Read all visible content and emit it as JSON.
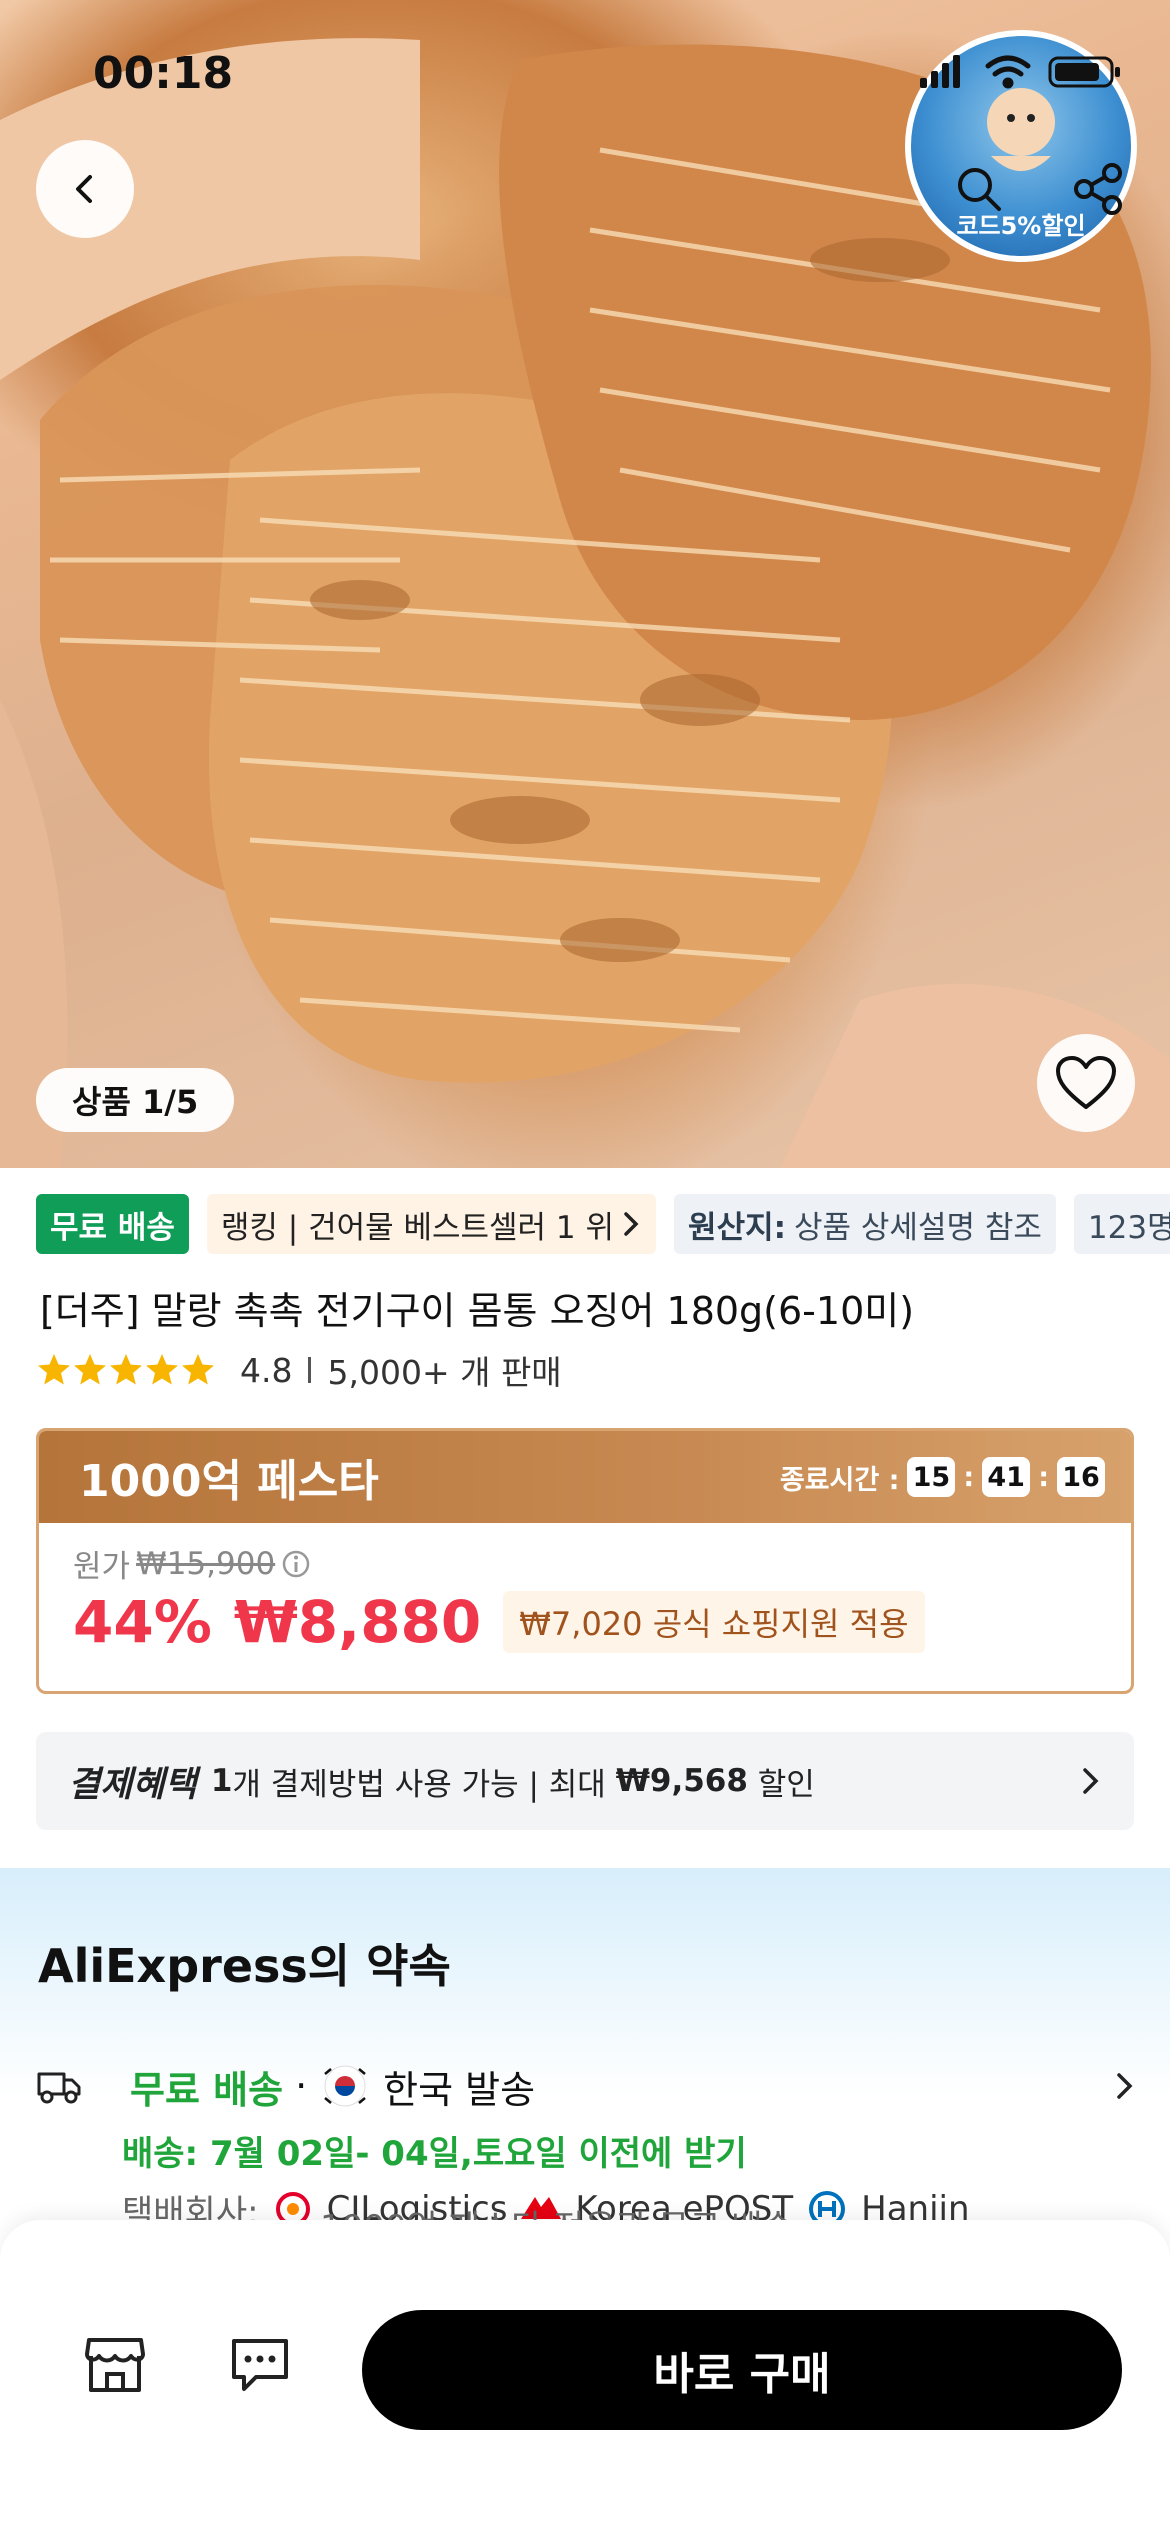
{
  "status": {
    "time": "00:18"
  },
  "brand_badge": {
    "text": "코드5%할인"
  },
  "gallery": {
    "counter": "상품 1/5"
  },
  "tags": {
    "free_shipping": "무료 배송",
    "ranking": "랭킹 | 건어물 베스트셀러 1 위",
    "origin_label": "원산지:",
    "origin_value": "상품 상세설명 참조",
    "more": "123명"
  },
  "product": {
    "title": "[더주] 말랑 촉촉 전기구이 몸통 오징어 180g(6-10미)",
    "rating": "4.8",
    "sold": "5,000+ 개 판매",
    "stars": 5
  },
  "fiesta": {
    "title": "1000억 페스타",
    "ends_label": "종료시간 :",
    "hours": "15",
    "minutes": "41",
    "seconds": "16",
    "original_label": "원가",
    "original_price": "₩15,900",
    "discount": "44%",
    "final_price": "₩8,880",
    "coupon": "₩7,020 공식 쇼핑지원 적용"
  },
  "payment": {
    "label": "결제혜택",
    "count": "1",
    "text": "개 결제방법 사용 가능 | 최대 ",
    "max": "₩9,568",
    "suffix": " 할인"
  },
  "promise": {
    "title": "AliExpress의 약속",
    "free_shipping": "무료 배송",
    "dot": "·",
    "origin": "한국 발송",
    "delivery": "배송: 7월 02일- 04일,토요일 이전에 받기",
    "carrier_label": "택배회사:",
    "carriers": [
      "CJLogistics",
      "Korea ePOST",
      "Hanjin"
    ],
    "behind_text": "1000억 페스타 전용관 무료 배송"
  },
  "bottom": {
    "buy_label": "바로 구매"
  },
  "colors": {
    "accent_red": "#f0364a",
    "green": "#1fa53a",
    "fiesta_brown": "#b4743a"
  }
}
